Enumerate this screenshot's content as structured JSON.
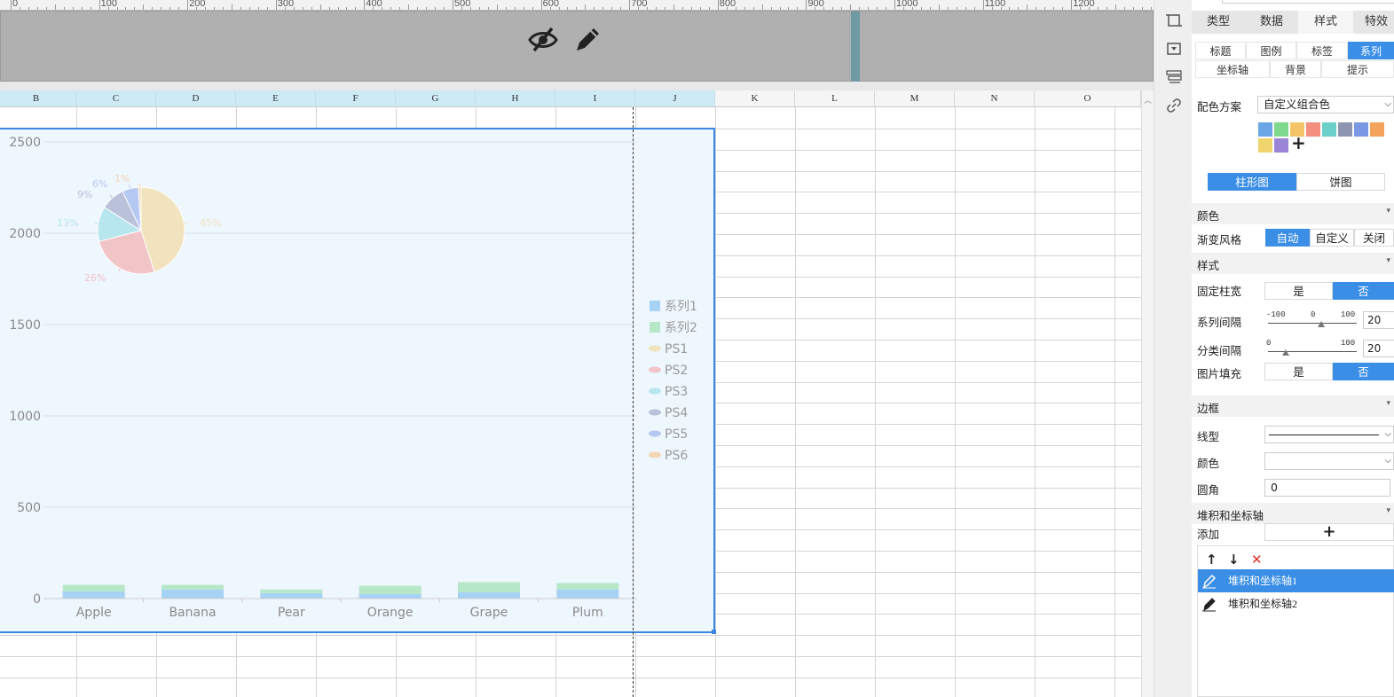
{
  "ruler": {
    "labels": [
      "0",
      "100",
      "200",
      "300",
      "400",
      "500",
      "600",
      "700",
      "800",
      "900",
      "1000",
      "1100",
      "1200"
    ]
  },
  "banner": {
    "icons": [
      "eye-slash-icon",
      "pencil-icon"
    ]
  },
  "sheet": {
    "columns": [
      "B",
      "C",
      "D",
      "E",
      "F",
      "G",
      "H",
      "I",
      "J",
      "K",
      "L",
      "M",
      "N",
      "O"
    ]
  },
  "chart_data": {
    "type": "bar",
    "categories": [
      "Apple",
      "Banana",
      "Pear",
      "Orange",
      "Grape",
      "Plum"
    ],
    "series": [
      {
        "name": "系列1",
        "values": [
          40,
          50,
          30,
          25,
          35,
          50
        ],
        "color": "#a6d2f5"
      },
      {
        "name": "系列2",
        "values": [
          35,
          25,
          20,
          45,
          55,
          35
        ],
        "color": "#b6e8c7"
      }
    ],
    "ylim": [
      0,
      2500
    ],
    "yticks": [
      "0",
      "500",
      "1000",
      "1500",
      "2000",
      "2500"
    ],
    "grid": true,
    "legend_placement": "right",
    "pie": {
      "series_names": [
        "PS1",
        "PS2",
        "PS3",
        "PS4",
        "PS5",
        "PS6"
      ],
      "percents": [
        45,
        26,
        13,
        9,
        6,
        1
      ],
      "labels": [
        "45%",
        "26%",
        "13%",
        "9%",
        "6%",
        "1%"
      ],
      "colors": [
        "#f1e3bd",
        "#f1c4c8",
        "#b7e6ef",
        "#b9c2da",
        "#b5c8f2",
        "#f3d6b4"
      ]
    }
  },
  "strip": {
    "icons": [
      "crop-icon",
      "dropdown-box-icon",
      "layers-icon",
      "link-icon"
    ]
  },
  "panel": {
    "main_tabs": [
      "类型",
      "数据",
      "样式",
      "特效"
    ],
    "main_active": 2,
    "sub_tabs_row1": [
      "标题",
      "图例",
      "标签",
      "系列"
    ],
    "sub_tabs_row2": [
      "坐标轴",
      "背景",
      "提示"
    ],
    "sub_active": "系列",
    "color_scheme_label": "配色方案",
    "color_scheme_value": "自定义组合色",
    "swatches": [
      "#6aa6e6",
      "#7fd98c",
      "#f5c469",
      "#f48e7e",
      "#6bd0c7",
      "#8e95b0",
      "#7a98e3",
      "#f4a35c",
      "#f0d46d",
      "#9a85d6"
    ],
    "chart_toggle": [
      "柱形图",
      "饼图"
    ],
    "section_color": "颜色",
    "gradient_label": "渐变风格",
    "gradient_options": [
      "自动",
      "自定义",
      "关闭"
    ],
    "section_style": "样式",
    "fixed_width_label": "固定柱宽",
    "yes": "是",
    "no": "否",
    "series_gap_label": "系列间隔",
    "series_gap_scale": [
      "-100",
      "0",
      "100"
    ],
    "series_gap_value": "20",
    "category_gap_label": "分类间隔",
    "category_gap_scale": [
      "0",
      "100"
    ],
    "category_gap_value": "20",
    "image_fill_label": "图片填充",
    "section_border": "边框",
    "line_type_label": "线型",
    "border_color_label": "颜色",
    "corner_label": "圆角",
    "corner_value": "0",
    "section_stack": "堆积和坐标轴",
    "add_label": "添加",
    "add_icon": "plus-icon",
    "list_tools": [
      "↑",
      "↓",
      "✕"
    ],
    "axis_items": [
      "堆积和坐标轴1",
      "堆积和坐标轴2"
    ]
  }
}
